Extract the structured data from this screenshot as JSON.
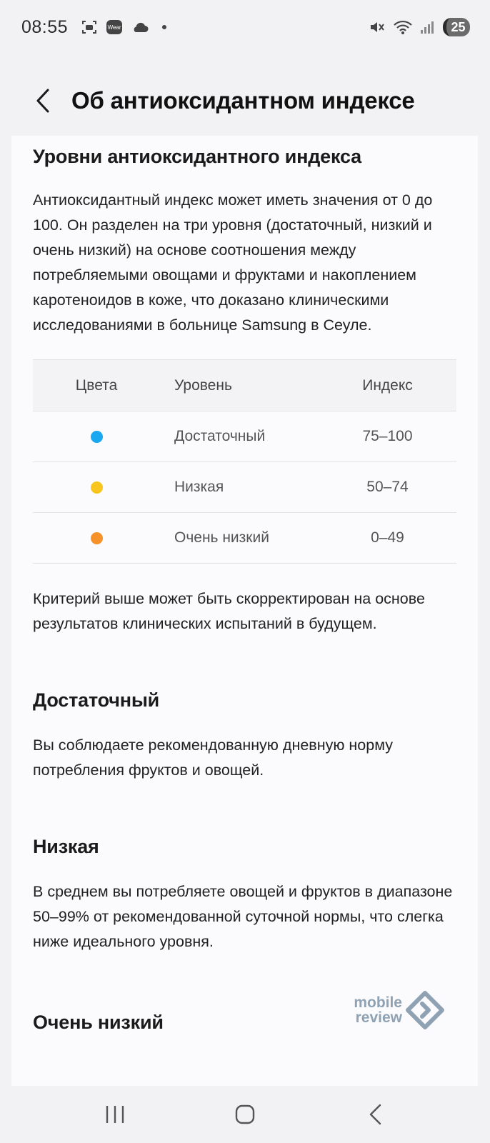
{
  "status_bar": {
    "time": "08:55",
    "wear_label": "Wear",
    "battery": "25"
  },
  "header": {
    "title": "Об антиоксидантном индексе"
  },
  "content": {
    "levels_title": "Уровни антиоксидантного индекса",
    "levels_text": "Антиоксидантный индекс может иметь значения от 0 до 100. Он разделен на три уровня (достаточный, низкий и очень низкий) на основе соотношения между потребляемыми овощами и фруктами и накоплением каротеноидов в коже, что доказано клиническими исследованиями в больнице Samsung в Сеуле.",
    "table": {
      "headers": [
        "Цвета",
        "Уровень",
        "Индекс"
      ],
      "rows": [
        {
          "color": "#1aa8f0",
          "level": "Достаточный",
          "index": "75–100"
        },
        {
          "color": "#f7c51d",
          "level": "Низкая",
          "index": "50–74"
        },
        {
          "color": "#f5922b",
          "level": "Очень низкий",
          "index": "0–49"
        }
      ]
    },
    "criteria_text": "Критерий выше может быть скорректирован на основе результатов клинических испытаний в будущем.",
    "sufficient_title": "Достаточный",
    "sufficient_text": "Вы соблюдаете рекомендованную дневную норму потребления фруктов и овощей.",
    "low_title": "Низкая",
    "low_text": "В среднем вы потребляете овощей и фруктов в диапазоне 50–99% от рекомендованной суточной нормы, что слегка ниже идеального уровня.",
    "very_low_title": "Очень низкий"
  },
  "watermark": {
    "line1": "mobile",
    "line2": "review"
  },
  "colors": {
    "sufficient": "#1aa8f0",
    "low": "#f7c51d",
    "very_low": "#f5922b"
  }
}
